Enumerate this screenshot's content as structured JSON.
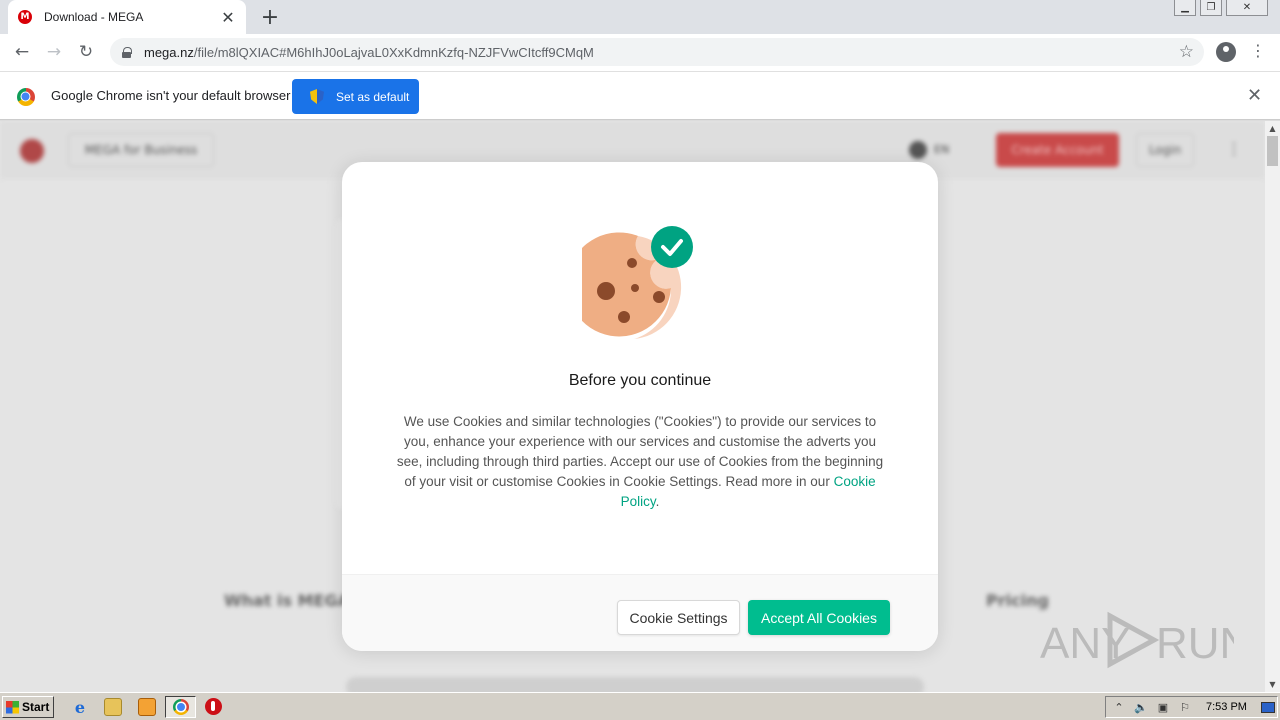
{
  "browser": {
    "tab_title": "Download - MEGA",
    "tab_favicon_letter": "M",
    "url_host": "mega.nz",
    "url_path": "/file/m8lQXIAC#M6hIhJ0oLajvaL0XxKdmnKzfq-NZJFVwCItcff9CMqM"
  },
  "infobar": {
    "message": "Google Chrome isn't your default browser",
    "button_label": "Set as default"
  },
  "background_page": {
    "business_label": "MEGA for Business",
    "language": "EN",
    "create_account_label": "Create Account",
    "login_label": "Login",
    "what_is_label": "What is MEGA",
    "pricing_label": "Pricing"
  },
  "modal": {
    "title": "Before you continue",
    "body_text": "We use Cookies and similar technologies (\"Cookies\") to provide our services to you, enhance your experience with our services and customise the adverts you see, including through third parties. Accept our use of Cookies from the beginning of your visit or customise Cookies in Cookie Settings. Read more in our",
    "policy_link": "Cookie Policy",
    "body_end": ".",
    "settings_button": "Cookie Settings",
    "accept_button": "Accept All Cookies",
    "accent_color": "#00bd8f"
  },
  "watermark": {
    "text_left": "ANY",
    "text_right": "RUN"
  },
  "taskbar": {
    "start_label": "Start",
    "clock": "7:53 PM",
    "tray_icons": [
      "expand-tray-icon",
      "volume-icon",
      "network-icon",
      "flag-icon"
    ]
  }
}
